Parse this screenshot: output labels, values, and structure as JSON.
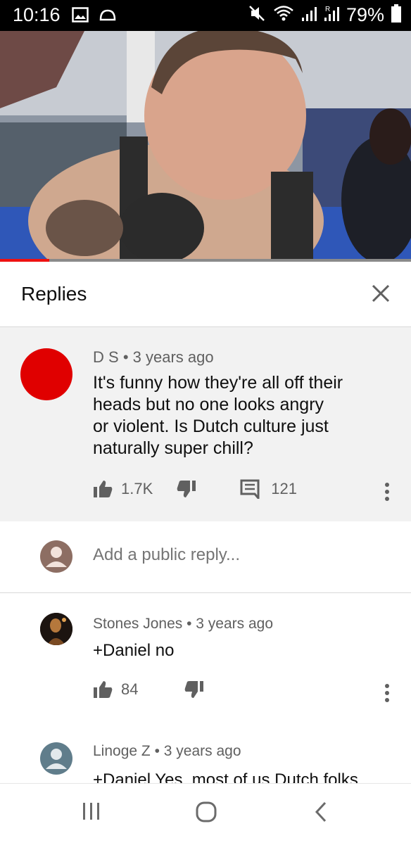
{
  "status_bar": {
    "time": "10:16",
    "battery": "79%",
    "icons": [
      "image-icon",
      "cloud-icon",
      "mute-icon",
      "wifi-icon",
      "signal-icon",
      "roaming-signal-icon",
      "battery-icon"
    ]
  },
  "video": {
    "progress_percent": 12
  },
  "replies_panel": {
    "title": "Replies"
  },
  "main_comment": {
    "author": "D S",
    "time": "3 years ago",
    "text_lines": [
      "It's funny how they're all off their",
      "heads but no one looks angry",
      "or violent. Is Dutch culture just",
      "naturally super chill?"
    ],
    "likes": "1.7K",
    "reply_count": "121",
    "avatar_color": "#e00000"
  },
  "add_reply": {
    "placeholder": "Add a public reply..."
  },
  "replies": [
    {
      "author": "Stones Jones",
      "time": "3 years ago",
      "text": "+Daniel no",
      "likes": "84"
    },
    {
      "author": "Linoge Z",
      "time": "3 years ago",
      "text": "+Daniel Yes, most of us Dutch folks"
    }
  ],
  "colors": {
    "accent": "#e00000",
    "secondary_text": "#606060",
    "comment_bg": "#f2f2f2"
  }
}
